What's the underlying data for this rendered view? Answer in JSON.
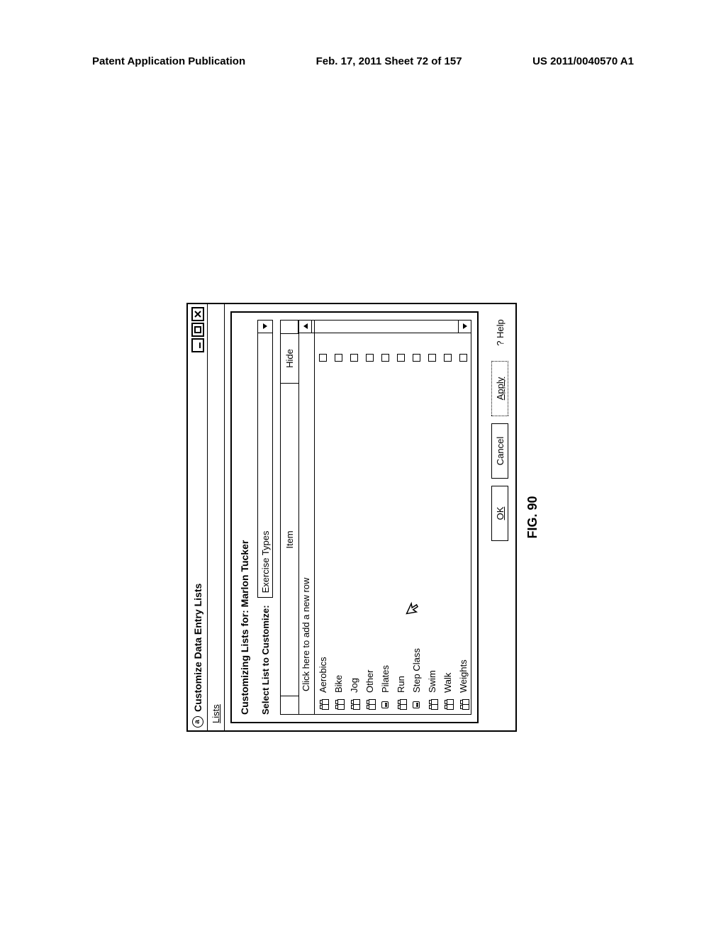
{
  "page_header": {
    "left": "Patent Application Publication",
    "center": "Feb. 17, 2011  Sheet 72 of 157",
    "right": "US 2011/0040570 A1"
  },
  "window": {
    "title": "Customize Data Entry Lists",
    "icon_glyph": "a"
  },
  "menu": {
    "lists": "Lists"
  },
  "panel": {
    "title": "Customizing Lists for: Marlon Tucker",
    "select_label": "Select List to Customize:",
    "select_value": "Exercise Types"
  },
  "grid": {
    "col_item": "Item",
    "col_hide": "Hide",
    "new_row_text": "Click here to add a new row",
    "rows": [
      {
        "label": "Aerobics",
        "icon": "dbl"
      },
      {
        "label": "Bike",
        "icon": "dbl"
      },
      {
        "label": "Jog",
        "icon": "dbl"
      },
      {
        "label": "Other",
        "icon": "dbl"
      },
      {
        "label": "Pilates",
        "icon": "single"
      },
      {
        "label": "Run",
        "icon": "dbl"
      },
      {
        "label": "Step Class",
        "icon": "single"
      },
      {
        "label": "Swim",
        "icon": "dbl"
      },
      {
        "label": "Walk",
        "icon": "dbl"
      },
      {
        "label": "Weights",
        "icon": "dbl"
      }
    ]
  },
  "buttons": {
    "ok": "OK",
    "cancel": "Cancel",
    "apply": "Apply",
    "help": "? Help"
  },
  "figure_label": "FIG. 90"
}
